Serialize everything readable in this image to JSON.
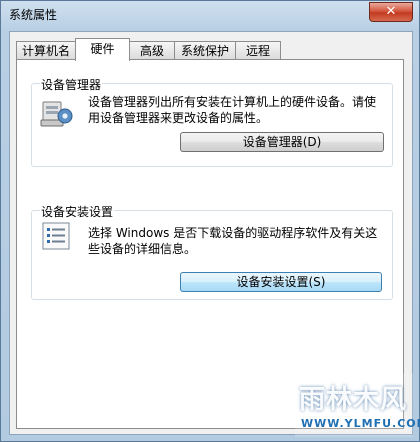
{
  "window": {
    "title": "系统属性",
    "close_label": "✕"
  },
  "tabs": [
    {
      "label": "计算机名"
    },
    {
      "label": "硬件"
    },
    {
      "label": "高级"
    },
    {
      "label": "系统保护"
    },
    {
      "label": "远程"
    }
  ],
  "active_tab": "硬件",
  "device_manager": {
    "title": "设备管理器",
    "description": "设备管理器列出所有安装在计算机上的硬件设备。请使用设备管理器来更改设备的属性。",
    "button_label": "设备管理器(D)",
    "icon": "computer-settings-icon"
  },
  "device_install": {
    "title": "设备安装设置",
    "description": "选择 Windows 是否下载设备的驱动程序软件及有关这些设备的详细信息。",
    "button_label": "设备安装设置(S)",
    "icon": "checklist-icon"
  },
  "watermark": {
    "text": "雨林木风",
    "url": "WWW.YLMFU.COM"
  },
  "colors": {
    "accent": "#3c7fb1",
    "title_bar": "#b8cfe4",
    "close": "#c23a20"
  }
}
